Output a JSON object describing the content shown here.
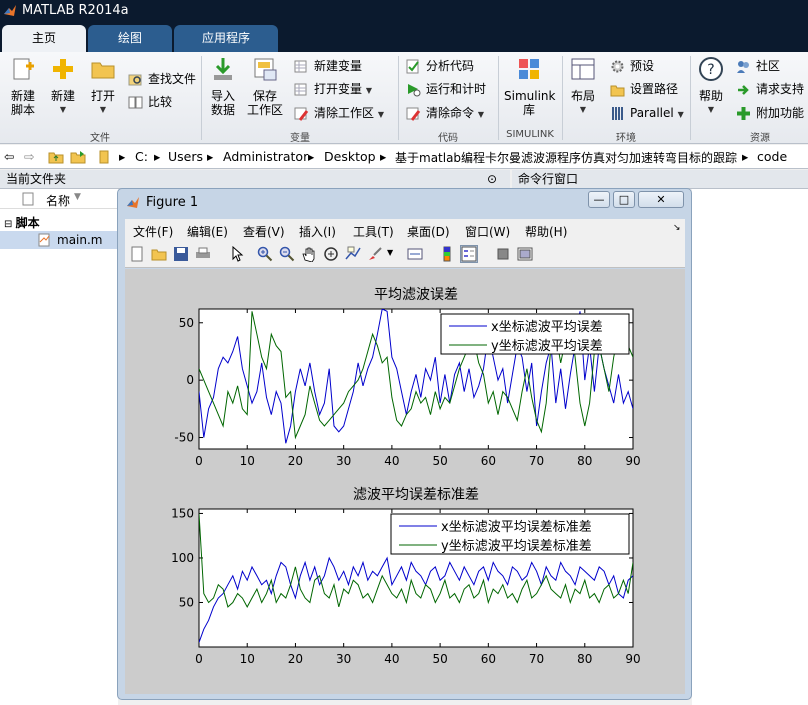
{
  "app": {
    "title": "MATLAB R2014a"
  },
  "tabs": [
    {
      "label": "主页"
    },
    {
      "label": "绘图"
    },
    {
      "label": "应用程序"
    }
  ],
  "ribbon": {
    "file": {
      "new_script": "新建\n脚本",
      "new": "新建",
      "open": "打开",
      "find_files": "查找文件",
      "compare": "比较",
      "group": "文件"
    },
    "variable": {
      "import": "导入\n数据",
      "save_ws": "保存\n工作区",
      "new_var": "新建变量",
      "open_var": "打开变量",
      "clear_ws": "清除工作区",
      "group": "变量"
    },
    "code": {
      "analyze": "分析代码",
      "run_time": "运行和计时",
      "clear_cmd": "清除命令",
      "group": "代码"
    },
    "simulink": {
      "lib": "Simulink\n库",
      "group": "SIMULINK"
    },
    "env": {
      "layout": "布局",
      "prefs": "预设",
      "set_path": "设置路径",
      "parallel": "Parallel",
      "group": "环境"
    },
    "resources": {
      "help": "帮助",
      "community": "社区",
      "support": "请求支持",
      "addons": "附加功能",
      "group": "资源"
    }
  },
  "address": {
    "crumbs": [
      "C:",
      "Users",
      "Administrator",
      "Desktop",
      "基于matlab编程卡尔曼滤波源程序仿真对匀加速转弯目标的跟踪",
      "code"
    ]
  },
  "left_panel": {
    "title": "当前文件夹",
    "col_name": "名称",
    "group": "脚本",
    "file": "main.m"
  },
  "right_panel": {
    "title": "命令行窗口"
  },
  "figure": {
    "title": "Figure 1",
    "menus": [
      "文件(F)",
      "编辑(E)",
      "查看(V)",
      "插入(I)",
      "工具(T)",
      "桌面(D)",
      "窗口(W)",
      "帮助(H)"
    ]
  },
  "colors": {
    "x_series": "#0000cc",
    "y_series": "#006600",
    "title_bg": "#0b1a2e",
    "tab_bg": "#2c5d8f"
  },
  "chart_data": [
    {
      "type": "line",
      "title": "平均滤波误差",
      "xlabel": "",
      "ylabel": "",
      "xlim": [
        0,
        90
      ],
      "ylim": [
        -60,
        62
      ],
      "xticks": [
        0,
        10,
        20,
        30,
        40,
        50,
        60,
        70,
        80,
        90
      ],
      "yticks": [
        -50,
        0,
        50
      ],
      "legend": "top-right",
      "series": [
        {
          "name": "x坐标滤波平均误差",
          "x": [
            0,
            1,
            2,
            3,
            4,
            5,
            6,
            7,
            8,
            9,
            10,
            11,
            12,
            13,
            14,
            15,
            16,
            17,
            18,
            19,
            20,
            21,
            22,
            23,
            24,
            25,
            26,
            27,
            28,
            29,
            30,
            31,
            32,
            33,
            34,
            35,
            36,
            37,
            38,
            39,
            40,
            41,
            42,
            43,
            44,
            45,
            46,
            47,
            48,
            49,
            50,
            51,
            52,
            53,
            54,
            55,
            56,
            57,
            58,
            59,
            60,
            61,
            62,
            63,
            64,
            65,
            66,
            67,
            68,
            69,
            70,
            71,
            72,
            73,
            74,
            75,
            76,
            77,
            78,
            79,
            80,
            81,
            82,
            83,
            84,
            85,
            86,
            87,
            88,
            89,
            90
          ],
          "values": [
            -10,
            -50,
            -25,
            -15,
            10,
            20,
            15,
            25,
            38,
            10,
            -5,
            -20,
            -10,
            15,
            -15,
            -30,
            -10,
            -20,
            -55,
            -40,
            -10,
            10,
            -5,
            15,
            -10,
            -30,
            -20,
            10,
            -40,
            -45,
            -40,
            -25,
            -10,
            15,
            -5,
            10,
            20,
            40,
            62,
            60,
            20,
            10,
            -10,
            -30,
            -10,
            5,
            -15,
            10,
            0,
            20,
            -20,
            5,
            -20,
            5,
            15,
            -10,
            10,
            -15,
            -5,
            10,
            40,
            20,
            0,
            10,
            -20,
            5,
            30,
            20,
            -10,
            15,
            -40,
            -10,
            15,
            30,
            -20,
            10,
            -25,
            5,
            30,
            60,
            0,
            30,
            -10,
            30,
            10,
            -5,
            -20,
            5,
            -20,
            -10,
            -25
          ]
        },
        {
          "name": "y坐标滤波平均误差",
          "x": [
            0,
            1,
            2,
            3,
            4,
            5,
            6,
            7,
            8,
            9,
            10,
            11,
            12,
            13,
            14,
            15,
            16,
            17,
            18,
            19,
            20,
            21,
            22,
            23,
            24,
            25,
            26,
            27,
            28,
            29,
            30,
            31,
            32,
            33,
            34,
            35,
            36,
            37,
            38,
            39,
            40,
            41,
            42,
            43,
            44,
            45,
            46,
            47,
            48,
            49,
            50,
            51,
            52,
            53,
            54,
            55,
            56,
            57,
            58,
            59,
            60,
            61,
            62,
            63,
            64,
            65,
            66,
            67,
            68,
            69,
            70,
            71,
            72,
            73,
            74,
            75,
            76,
            77,
            78,
            79,
            80,
            81,
            82,
            83,
            84,
            85,
            86,
            87,
            88,
            89,
            90
          ],
          "values": [
            10,
            0,
            -10,
            -20,
            -30,
            -40,
            -10,
            -20,
            -5,
            -25,
            -30,
            60,
            40,
            20,
            10,
            40,
            30,
            25,
            -15,
            -10,
            -50,
            -40,
            -30,
            -5,
            -20,
            -35,
            -40,
            -35,
            -30,
            -25,
            -20,
            -10,
            -5,
            0,
            10,
            25,
            40,
            30,
            15,
            20,
            -15,
            -35,
            -40,
            -30,
            -25,
            -10,
            -20,
            -15,
            -30,
            -10,
            -25,
            -15,
            -20,
            -5,
            10,
            20,
            30,
            35,
            15,
            5,
            -20,
            -10,
            -30,
            -10,
            -15,
            -25,
            -35,
            -10,
            10,
            -15,
            -35,
            -45,
            -20,
            30,
            40,
            15,
            35,
            50,
            20,
            -20,
            -40,
            -20,
            25,
            30,
            10,
            -10,
            20,
            40,
            50,
            30,
            20
          ]
        }
      ]
    },
    {
      "type": "line",
      "title": "滤波平均误差标准差",
      "xlabel": "",
      "ylabel": "",
      "xlim": [
        0,
        90
      ],
      "ylim": [
        0,
        155
      ],
      "xticks": [
        0,
        10,
        20,
        30,
        40,
        50,
        60,
        70,
        80,
        90
      ],
      "yticks": [
        50,
        100,
        150
      ],
      "legend": "top-right",
      "series": [
        {
          "name": "x坐标滤波平均误差标准差",
          "x": [
            0,
            1,
            2,
            3,
            4,
            5,
            6,
            7,
            8,
            9,
            10,
            11,
            12,
            13,
            14,
            15,
            16,
            17,
            18,
            19,
            20,
            21,
            22,
            23,
            24,
            25,
            26,
            27,
            28,
            29,
            30,
            31,
            32,
            33,
            34,
            35,
            36,
            37,
            38,
            39,
            40,
            41,
            42,
            43,
            44,
            45,
            46,
            47,
            48,
            49,
            50,
            51,
            52,
            53,
            54,
            55,
            56,
            57,
            58,
            59,
            60,
            61,
            62,
            63,
            64,
            65,
            66,
            67,
            68,
            69,
            70,
            71,
            72,
            73,
            74,
            75,
            76,
            77,
            78,
            79,
            80,
            81,
            82,
            83,
            84,
            85,
            86,
            87,
            88,
            89,
            90
          ],
          "values": [
            5,
            20,
            30,
            45,
            55,
            60,
            70,
            80,
            65,
            85,
            75,
            90,
            80,
            70,
            75,
            60,
            80,
            95,
            90,
            70,
            55,
            80,
            95,
            75,
            90,
            70,
            80,
            100,
            90,
            75,
            85,
            70,
            90,
            80,
            95,
            75,
            85,
            80,
            90,
            100,
            70,
            80,
            90,
            75,
            95,
            85,
            80,
            70,
            85,
            90,
            75,
            80,
            95,
            85,
            75,
            90,
            80,
            70,
            85,
            90,
            75,
            95,
            85,
            80,
            70,
            90,
            85,
            75,
            80,
            95,
            85,
            70,
            90,
            80,
            75,
            95,
            85,
            80,
            70,
            90,
            85,
            80,
            75,
            90,
            85,
            70,
            80,
            60,
            55,
            75,
            80
          ]
        },
        {
          "name": "y坐标滤波平均误差标准差",
          "x": [
            0,
            1,
            2,
            3,
            4,
            5,
            6,
            7,
            8,
            9,
            10,
            11,
            12,
            13,
            14,
            15,
            16,
            17,
            18,
            19,
            20,
            21,
            22,
            23,
            24,
            25,
            26,
            27,
            28,
            29,
            30,
            31,
            32,
            33,
            34,
            35,
            36,
            37,
            38,
            39,
            40,
            41,
            42,
            43,
            44,
            45,
            46,
            47,
            48,
            49,
            50,
            51,
            52,
            53,
            54,
            55,
            56,
            57,
            58,
            59,
            60,
            61,
            62,
            63,
            64,
            65,
            66,
            67,
            68,
            69,
            70,
            71,
            72,
            73,
            74,
            75,
            76,
            77,
            78,
            79,
            80,
            81,
            82,
            83,
            84,
            85,
            86,
            87,
            88,
            89,
            90
          ],
          "values": [
            150,
            60,
            50,
            55,
            70,
            65,
            45,
            50,
            60,
            55,
            45,
            55,
            65,
            50,
            60,
            75,
            50,
            60,
            55,
            70,
            90,
            65,
            55,
            50,
            75,
            80,
            60,
            55,
            70,
            45,
            65,
            60,
            75,
            70,
            55,
            60,
            50,
            65,
            80,
            70,
            60,
            55,
            65,
            50,
            75,
            60,
            55,
            70,
            65,
            50,
            60,
            75,
            55,
            60,
            50,
            65,
            70,
            55,
            60,
            75,
            50,
            65,
            60,
            70,
            55,
            60,
            50,
            65,
            75,
            55,
            60,
            70,
            80,
            65,
            60,
            55,
            70,
            50,
            65,
            60,
            75,
            55,
            60,
            50,
            65,
            70,
            55,
            60,
            75,
            60,
            95
          ]
        }
      ]
    }
  ]
}
